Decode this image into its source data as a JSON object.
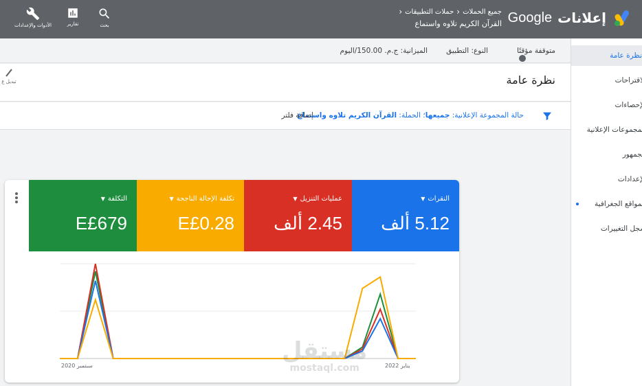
{
  "topbar": {
    "tools": [
      {
        "label": "الأدوات والإعدادات",
        "icon": "wrench-icon"
      },
      {
        "label": "تقارير",
        "icon": "reports-icon"
      },
      {
        "label": "بحث",
        "icon": "search-icon"
      }
    ],
    "brand_google": "Google",
    "brand_ads": "إعلانات",
    "breadcrumb": [
      "جميع الحملات",
      "حملات التطبيقات"
    ],
    "campaign_name": "القرآن الكريم تلاوه واستماع"
  },
  "status": {
    "state": "متوقفة مؤقتًا",
    "type": "النوع: التطبيق",
    "budget": "الميزانية: ج.م. 150.00/اليوم"
  },
  "page_title": "نظرة عامة",
  "toggle_view_label": "تبديل ع",
  "filter": {
    "text_prefix": "حالة المجموعة الإعلانية: ",
    "adgroup_value": "جميعها",
    "campaign_prefix": "؛ الحملة: ",
    "campaign_value": "القرآن الكريم تلاوه واستماع",
    "add_filter": "إضافة فلتر"
  },
  "sidenav": {
    "items": [
      {
        "label": "نظرة عامة",
        "active": true
      },
      {
        "label": "الاقتراحات",
        "active": false
      },
      {
        "label": "الإحصاءات",
        "active": false
      },
      {
        "label": "المجموعات الإعلانية",
        "active": false
      },
      {
        "label": "الجمهور",
        "active": false
      },
      {
        "label": "الإعدادات",
        "active": false
      },
      {
        "label": "المواقع الجغرافية",
        "active": false,
        "dot": true
      },
      {
        "label": "سجل التغييرات",
        "active": false
      }
    ]
  },
  "metrics": [
    {
      "label": "النقرات",
      "value": "5.12 ألف",
      "color": "#1a73e8"
    },
    {
      "label": "عمليات التنزيل",
      "value": "2.45 ألف",
      "color": "#d93025"
    },
    {
      "label": "تكلفة الإحالة الناجحة",
      "value": "E£0.28",
      "color": "#f9ab00"
    },
    {
      "label": "التكلفة",
      "value": "E£679",
      "color": "#1e8e3e"
    }
  ],
  "chart_data": {
    "type": "line",
    "x_start_label": "سبتمبر 2020",
    "x_end_label": "يناير 2022",
    "grid": true,
    "series": [
      {
        "color": "#1e8e3e",
        "values": [
          0,
          0,
          0.92,
          0,
          0,
          0,
          0,
          0,
          0,
          0,
          0,
          0,
          0,
          0,
          0,
          0,
          0,
          0.12,
          0.68,
          0,
          0
        ]
      },
      {
        "color": "#d93025",
        "values": [
          0,
          0,
          1.0,
          0,
          0,
          0,
          0,
          0,
          0,
          0,
          0,
          0,
          0,
          0,
          0,
          0,
          0,
          0.1,
          0.52,
          0,
          0
        ]
      },
      {
        "color": "#1a73e8",
        "values": [
          0,
          0,
          0.82,
          0,
          0,
          0,
          0,
          0,
          0,
          0,
          0,
          0,
          0,
          0,
          0,
          0,
          0,
          0.08,
          0.42,
          0,
          0
        ]
      },
      {
        "color": "#f9ab00",
        "values": [
          0,
          0,
          0.62,
          0,
          0,
          0,
          0,
          0,
          0,
          0,
          0,
          0,
          0,
          0,
          0,
          0,
          0,
          0.74,
          0.86,
          0,
          0
        ]
      }
    ]
  },
  "watermark": {
    "line1": "مستقل",
    "line2": "mostaql.com"
  }
}
